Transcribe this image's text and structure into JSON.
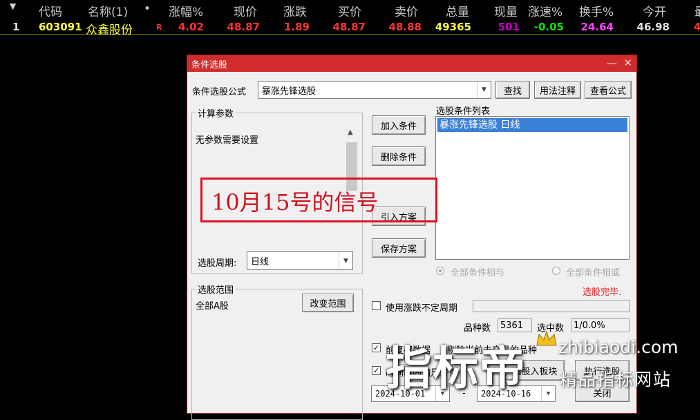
{
  "quote_table": {
    "sort_icon": "triangle-down-icon",
    "columns": {
      "code": "代码",
      "name": "名称(1)",
      "dot": "•",
      "change_pct": "涨幅%",
      "price": "现价",
      "change": "涨跌",
      "bid": "买价",
      "ask": "卖价",
      "volume": "总量",
      "cur_vol": "现量",
      "speed": "涨速%",
      "turnover": "换手%",
      "open": "今开",
      "cut": "最"
    },
    "row": {
      "index": "1",
      "code": "603091",
      "name": "众鑫股份",
      "flag": "R",
      "change_pct": "4.02",
      "price": "48.87",
      "change": "1.89",
      "bid": "48.87",
      "ask": "48.88",
      "volume": "49365",
      "cur_vol": "501",
      "speed": "-0.05",
      "turnover": "24.64",
      "open": "46.98",
      "cut": "4"
    },
    "colors": {
      "up": "#ff3232",
      "down": "#00e600",
      "code": "#ffff40",
      "volume": "#ffff40",
      "cur_vol": "#c000c0",
      "turnover": "#ff40ff",
      "neutral": "#e0e0e0"
    }
  },
  "dialog": {
    "title": "条件选股",
    "minimize_icon": "minimize-icon",
    "close_icon": "close-icon",
    "formula_label": "条件选股公式",
    "formula_value": "暴涨先锋选股",
    "find_button": "查找",
    "usage_button": "用法注释",
    "view_formula_button": "查看公式",
    "params_group": "计算参数",
    "params_text": "无参数需要设置",
    "add_condition": "加入条件",
    "delete_condition": "删除条件",
    "import_plan": "引入方案",
    "save_plan": "保存方案",
    "conditions_list_title": "选股条件列表",
    "conditions_list": [
      "暴涨先锋选股  日线"
    ],
    "period_label": "选股周期:",
    "period_value": "日线",
    "logic_and": "全部条件相与",
    "logic_or": "全部条件相或",
    "status_text": "选股完毕.",
    "range_group": "选股范围",
    "range_value": "全部A股",
    "change_range": "改变范围",
    "uncertain_period_label": "使用涨跌不定周期",
    "count_label": "品种数",
    "count_value": "5361",
    "selected_label": "选中数",
    "selected_value": "1/0.0%",
    "chk1_label": "前复权数据",
    "chk2_label": "剔除当前未交易的品种",
    "chk3_label": "时间段内满足条件",
    "select_to_block": "选股入板块",
    "run": "执行选股",
    "close": "关闭",
    "date_from": "2024-10-01",
    "date_sep": "-",
    "date_to": "2024-10-16"
  },
  "annotation": {
    "text": "10月15号的信号"
  },
  "watermark": {
    "main": "指标帝",
    "url": "zhibiaodi.com",
    "sub": "精品指标网站",
    "icon": "crown-icon"
  }
}
